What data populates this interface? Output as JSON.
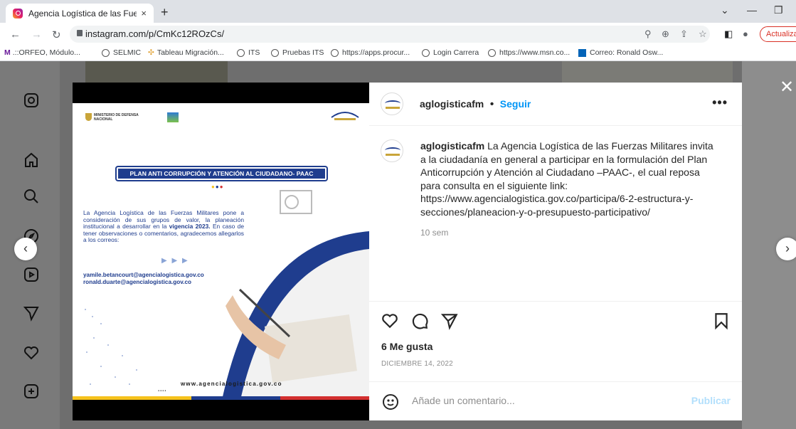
{
  "browser": {
    "tab_title": "Agencia Logística de las Fuerzas",
    "tab_close": "×",
    "new_tab": "+",
    "url": "instagram.com/p/CmKc12ROzCs/",
    "update_label": "Actualizar",
    "bookmarks": [
      "ORFEO, Módulo...",
      "SELMIC",
      "Tableau Migración...",
      "ITS",
      "Pruebas ITS",
      "https://apps.procur...",
      "Login Carrera",
      "https://www.msn.co...",
      "Correo: Ronald Osw..."
    ]
  },
  "post": {
    "username": "aglogisticafm",
    "separator": "•",
    "follow_label": "Seguir",
    "more": "•••",
    "caption_user": "aglogisticafm",
    "caption_text": "La Agencia Logística de las Fuerzas Militares invita a la ciudadanía en general a participar en la formulación del Plan Anticorrupción y Atención al Ciudadano –PAAC-, el cual reposa para consulta en el siguiente link: https://www.agencialogistica.gov.co/participa/6-2-estructura-y-secciones/planeacion-y-o-presupuesto-participativo/",
    "time_ago": "10 sem",
    "likes": "6 Me gusta",
    "date": "DICIEMBRE 14, 2022",
    "comment_placeholder": "Añade un comentario...",
    "publish_label": "Publicar"
  },
  "poster": {
    "ministry": "MINISTERIO DE DEFENSA NACIONAL",
    "banner": "PLAN ANTI CORRUPCIÓN Y ATENCIÓN AL CIUDADANO- PAAC",
    "body_pre": "La Agencia Logística de las Fuerzas Militares pone a consideración de sus grupos de valor, la planeación institucional a desarrollar en la ",
    "body_bold": "vigencia 2023.",
    "body_post": " En caso de tener observaciones o comentarios, agradecemos allegarlos a los correos:",
    "arrows": "▶ ▶ ▶",
    "email1": "yamile.betancourt@agencialogistica.gov.co",
    "email2": "ronald.duarte@agencialogistica.gov.co",
    "website": "www.agencialogistica.gov.co"
  }
}
